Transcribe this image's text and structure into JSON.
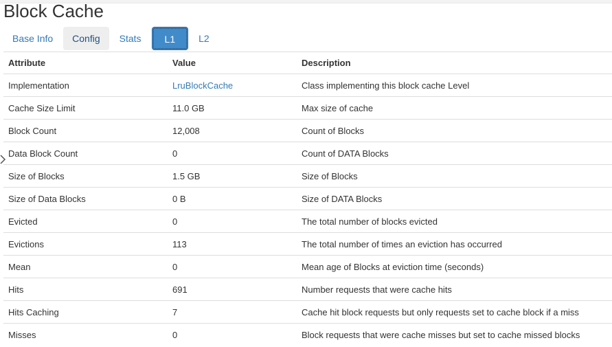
{
  "page": {
    "title": "Block Cache"
  },
  "tabs": [
    {
      "label": "Base Info"
    },
    {
      "label": "Config"
    },
    {
      "label": "Stats"
    },
    {
      "label": "L1"
    },
    {
      "label": "L2"
    }
  ],
  "table": {
    "headers": {
      "attribute": "Attribute",
      "value": "Value",
      "description": "Description"
    },
    "rows": [
      {
        "attribute": "Implementation",
        "value": "LruBlockCache",
        "description": "Class implementing this block cache Level"
      },
      {
        "attribute": "Cache Size Limit",
        "value": "11.0 GB",
        "description": "Max size of cache"
      },
      {
        "attribute": "Block Count",
        "value": "12,008",
        "description": "Count of Blocks"
      },
      {
        "attribute": "Data Block Count",
        "value": "0",
        "description": "Count of DATA Blocks"
      },
      {
        "attribute": "Size of Blocks",
        "value": "1.5 GB",
        "description": "Size of Blocks"
      },
      {
        "attribute": "Size of Data Blocks",
        "value": "0 B",
        "description": "Size of DATA Blocks"
      },
      {
        "attribute": "Evicted",
        "value": "0",
        "description": "The total number of blocks evicted"
      },
      {
        "attribute": "Evictions",
        "value": "113",
        "description": "The total number of times an eviction has occurred"
      },
      {
        "attribute": "Mean",
        "value": "0",
        "description": "Mean age of Blocks at eviction time (seconds)"
      },
      {
        "attribute": "Hits",
        "value": "691",
        "description": "Number requests that were cache hits"
      },
      {
        "attribute": "Hits Caching",
        "value": "7",
        "description": "Cache hit block requests but only requests set to cache block if a miss"
      },
      {
        "attribute": "Misses",
        "value": "0",
        "description": "Block requests that were cache misses but set to cache missed blocks"
      }
    ]
  },
  "icons": {
    "side_chevron": "chevron-right-icon"
  },
  "colors": {
    "link": "#337ab7",
    "active_tab_bg": "#428bca",
    "hover_tab_bg": "#eeeeee",
    "row_border": "#dddddd"
  }
}
